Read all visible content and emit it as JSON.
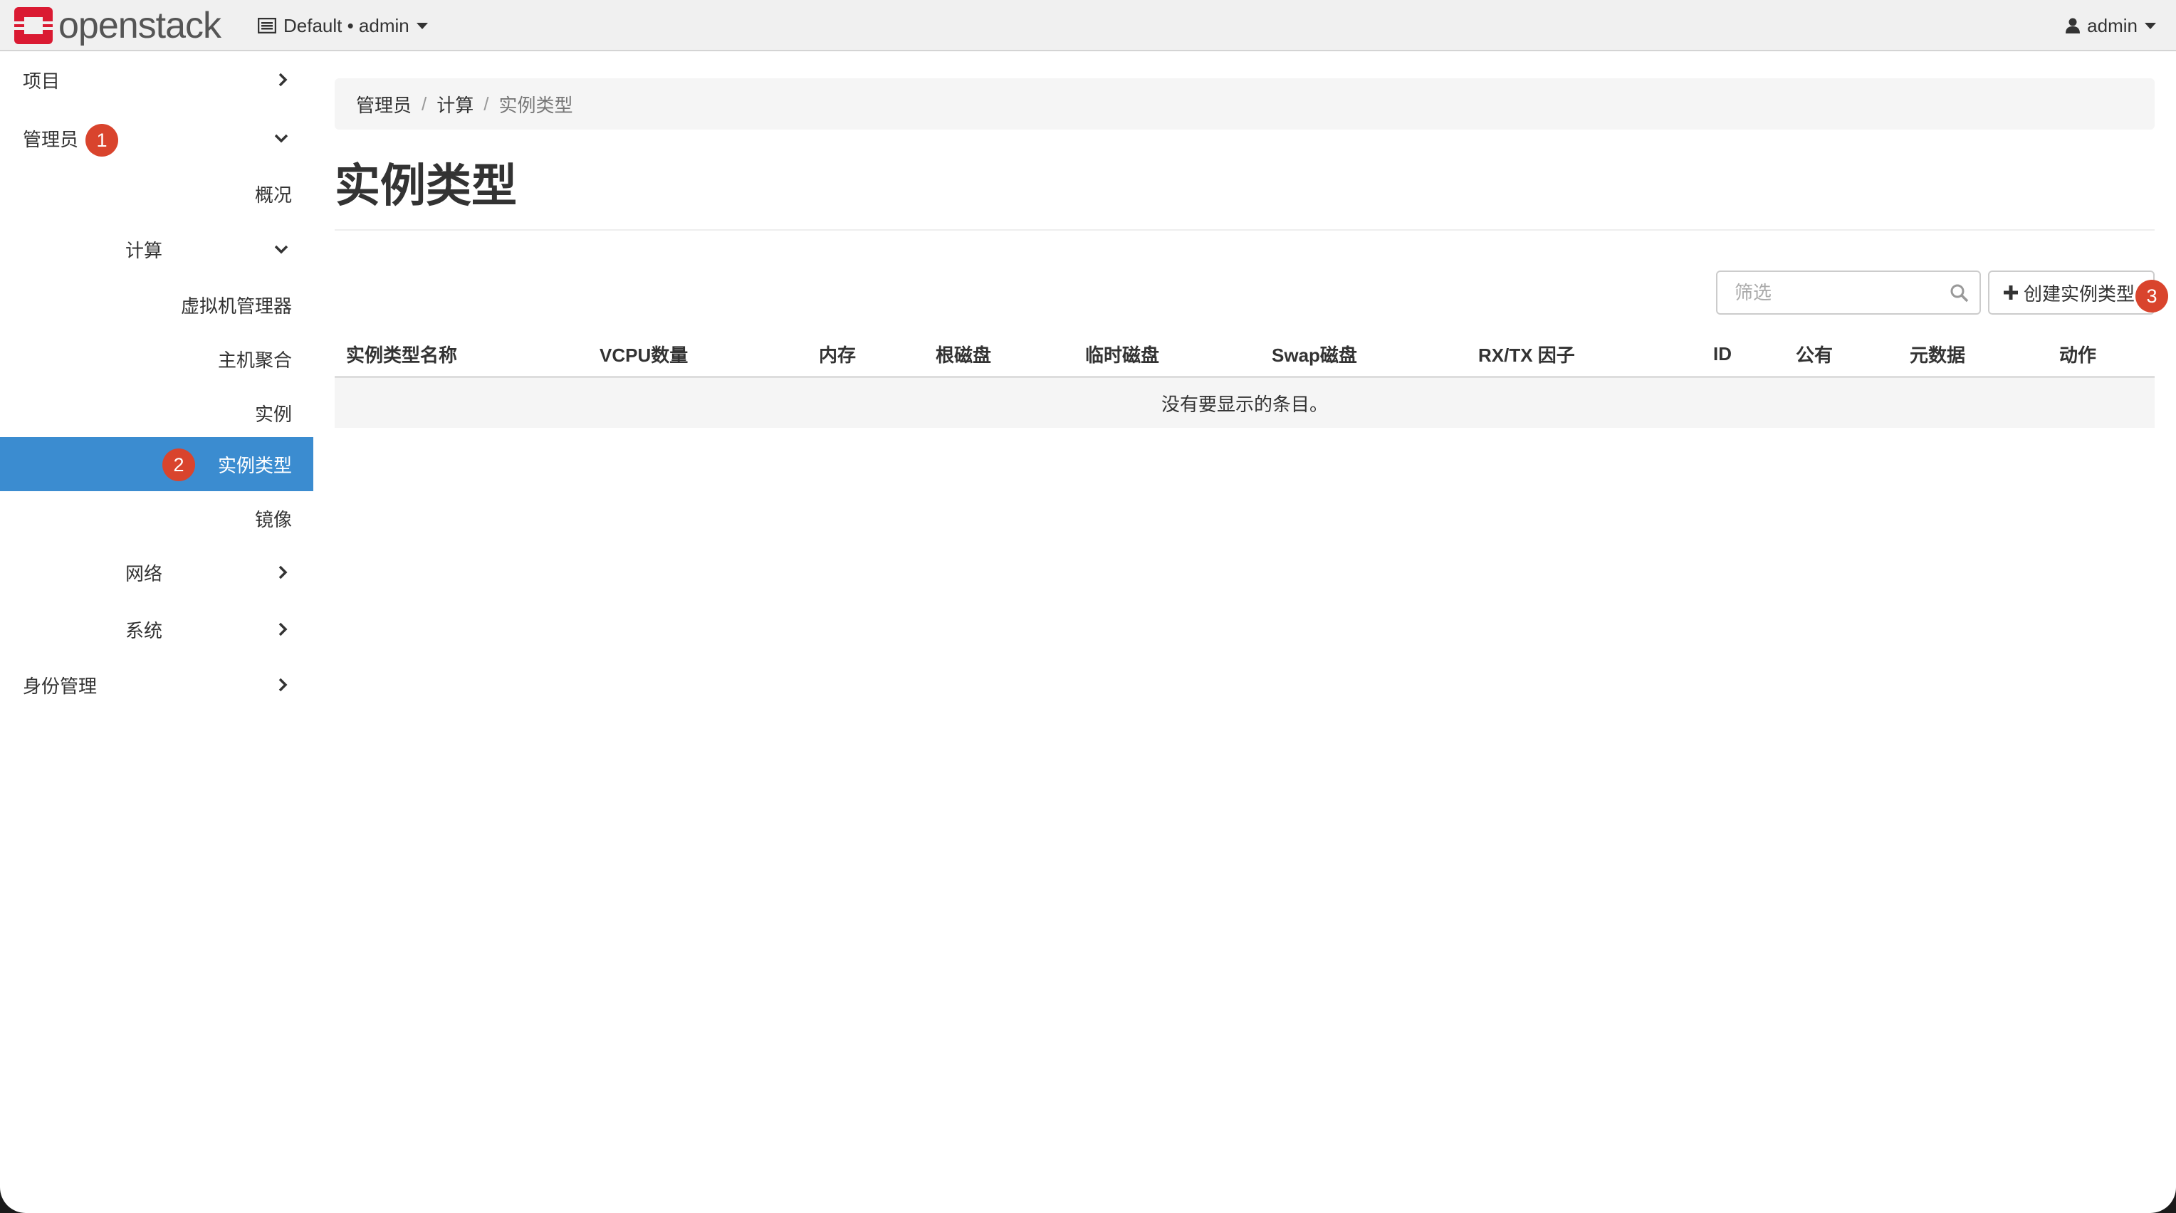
{
  "topbar": {
    "logo_text": "openstack",
    "project_selector": "Default • admin",
    "user": "admin"
  },
  "sidebar": {
    "project": "项目",
    "admin": "管理员",
    "overview": "概况",
    "compute": "计算",
    "hypervisors": "虚拟机管理器",
    "host_aggregates": "主机聚合",
    "instances": "实例",
    "flavors": "实例类型",
    "images": "镜像",
    "network": "网络",
    "system": "系统",
    "identity": "身份管理"
  },
  "badges": {
    "b1": "1",
    "b2": "2",
    "b3": "3"
  },
  "breadcrumb": {
    "level1": "管理员",
    "level2": "计算",
    "current": "实例类型"
  },
  "page_title": "实例类型",
  "filter": {
    "placeholder": "筛选"
  },
  "create_button": "创建实例类型",
  "table": {
    "columns": [
      "实例类型名称",
      "VCPU数量",
      "内存",
      "根磁盘",
      "临时磁盘",
      "Swap磁盘",
      "RX/TX 因子",
      "ID",
      "公有",
      "元数据",
      "动作"
    ],
    "empty_message": "没有要显示的条目。"
  },
  "colors": {
    "accent": "#3b8cd0",
    "badge": "#d9442d",
    "logo_red": "#da1a32"
  }
}
